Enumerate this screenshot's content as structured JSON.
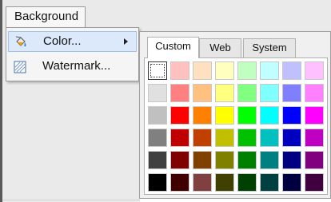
{
  "menubar": {
    "background_label": "Background"
  },
  "menu": {
    "items": [
      {
        "label": "Color...",
        "icon": "paint-bucket-icon",
        "has_submenu": true,
        "highlighted": true
      },
      {
        "label": "Watermark...",
        "icon": "watermark-icon",
        "has_submenu": false,
        "highlighted": false
      }
    ]
  },
  "picker": {
    "tabs": [
      {
        "label": "Custom",
        "active": true
      },
      {
        "label": "Web",
        "active": false
      },
      {
        "label": "System",
        "active": false
      }
    ],
    "selected_swatch": 0,
    "palette": [
      [
        "#ffffff",
        "#ffc0c0",
        "#ffe0c0",
        "#ffffc0",
        "#c0ffc0",
        "#c0ffff",
        "#c0c0ff",
        "#ffc0ff"
      ],
      [
        "#e0e0e0",
        "#ff8080",
        "#ffc080",
        "#ffff80",
        "#80ff80",
        "#80ffff",
        "#8080ff",
        "#ff80ff"
      ],
      [
        "#c0c0c0",
        "#ff0000",
        "#ff8000",
        "#ffff00",
        "#00ff00",
        "#00ffff",
        "#0000ff",
        "#ff00ff"
      ],
      [
        "#808080",
        "#c00000",
        "#c04000",
        "#c0c000",
        "#00c000",
        "#00c0c0",
        "#0000c0",
        "#c000c0"
      ],
      [
        "#404040",
        "#800000",
        "#804000",
        "#808000",
        "#008000",
        "#008080",
        "#000080",
        "#800080"
      ],
      [
        "#000000",
        "#400000",
        "#804040",
        "#404000",
        "#004000",
        "#004040",
        "#000040",
        "#400040"
      ]
    ]
  }
}
